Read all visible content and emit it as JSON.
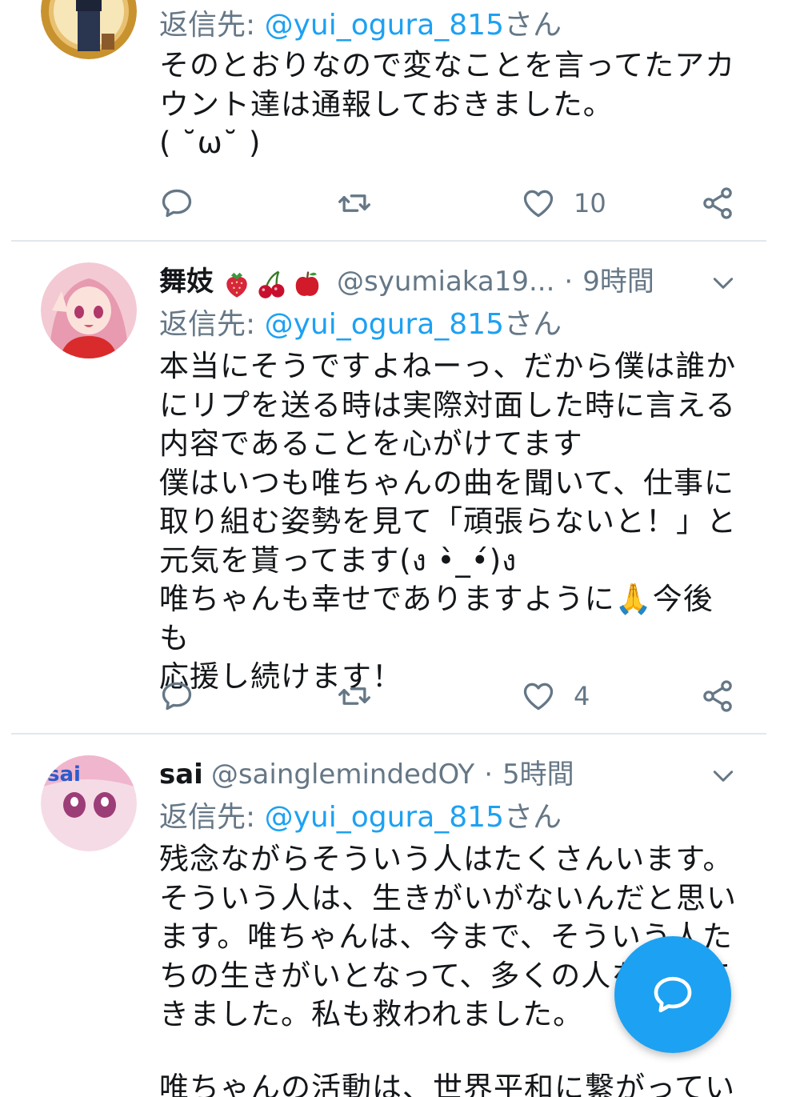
{
  "tweets": [
    {
      "display_name": "",
      "handle": "",
      "time": "",
      "reply_prefix": "返信先: ",
      "reply_mention": "@yui_ogura_815",
      "reply_suffix": "さん",
      "body": "そのとおりなので変なことを言ってたアカ\nウント達は通報しておきました。\n( ˘ω˘ )",
      "actions": {
        "reply_count": "",
        "retweet_count": "",
        "like_count": "10"
      }
    },
    {
      "display_name": "舞妓",
      "name_emojis": [
        "strawberry",
        "cherries",
        "red-apple"
      ],
      "handle": "@syumiaka19...",
      "time": "9時間",
      "reply_prefix": "返信先: ",
      "reply_mention": "@yui_ogura_815",
      "reply_suffix": "さん",
      "body": "本当にそうですよねーっ、だから僕は誰か\nにリプを送る時は実際対面した時に言える\n内容であることを心がけてます\n僕はいつも唯ちゃんの曲を聞いて、仕事に\n取り組む姿勢を見て「頑張らないと！」と\n元気を貰ってます(ง •̀_•́)ง\n唯ちゃんも幸せでありますように🙏今後も\n応援し続けます！",
      "actions": {
        "reply_count": "",
        "retweet_count": "",
        "like_count": "4"
      }
    },
    {
      "display_name": "sai",
      "handle": "@sainglemindedOY",
      "time": "5時間",
      "reply_prefix": "返信先: ",
      "reply_mention": "@yui_ogura_815",
      "reply_suffix": "さん",
      "body": "残念ながらそういう人はたくさんいます。\nそういう人は、生きがいがないんだと思い\nます。唯ちゃんは、今まで、そういう人た\nちの生きがいとなって、多くの人を救って\nきました。私も救われました。",
      "clipped_line": "唯ちゃんの活動は、世界平和に繋がってい",
      "actions": {
        "reply_count": "",
        "retweet_count": "",
        "like_count": ""
      }
    }
  ],
  "fab": {
    "icon": "compose-reply-icon"
  },
  "colors": {
    "accent": "#1da1f2",
    "secondary_text": "#657786",
    "primary_text": "#14171a",
    "divider": "#e1e8ed"
  }
}
